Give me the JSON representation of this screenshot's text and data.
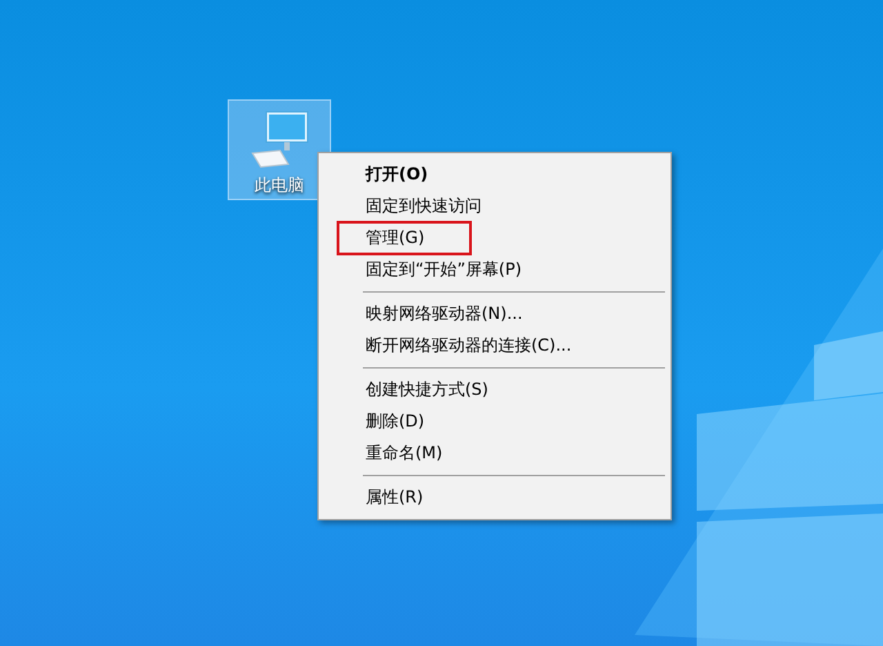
{
  "desktop_icon": {
    "label": "此电脑",
    "selected": true
  },
  "context_menu": [
    {
      "kind": "item",
      "label": "打开(O)",
      "default": true,
      "highlighted": false
    },
    {
      "kind": "item",
      "label": "固定到快速访问",
      "default": false,
      "highlighted": false
    },
    {
      "kind": "item",
      "label": "管理(G)",
      "default": false,
      "highlighted": true
    },
    {
      "kind": "item",
      "label": "固定到“开始”屏幕(P)",
      "default": false,
      "highlighted": false
    },
    {
      "kind": "separator"
    },
    {
      "kind": "item",
      "label": "映射网络驱动器(N)...",
      "default": false,
      "highlighted": false
    },
    {
      "kind": "item",
      "label": "断开网络驱动器的连接(C)...",
      "default": false,
      "highlighted": false
    },
    {
      "kind": "separator"
    },
    {
      "kind": "item",
      "label": "创建快捷方式(S)",
      "default": false,
      "highlighted": false
    },
    {
      "kind": "item",
      "label": "删除(D)",
      "default": false,
      "highlighted": false
    },
    {
      "kind": "item",
      "label": "重命名(M)",
      "default": false,
      "highlighted": false
    },
    {
      "kind": "separator"
    },
    {
      "kind": "item",
      "label": "属性(R)",
      "default": false,
      "highlighted": false
    }
  ]
}
